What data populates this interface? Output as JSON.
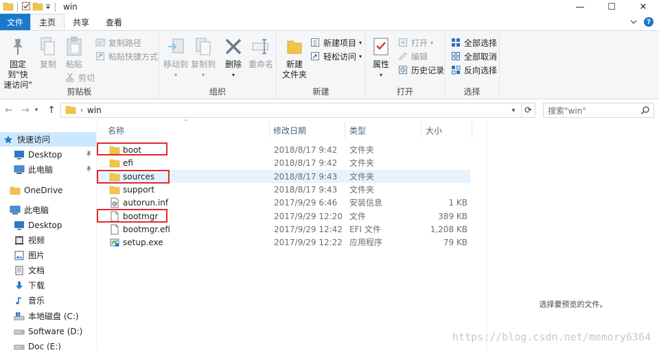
{
  "window": {
    "title": "win",
    "controls": {
      "minimize": "—",
      "maximize": "☐",
      "close": "✕"
    }
  },
  "tabs": [
    {
      "label": "文件"
    },
    {
      "label": "主页"
    },
    {
      "label": "共享"
    },
    {
      "label": "查看"
    }
  ],
  "ribbon": {
    "clipboard": {
      "label": "剪贴板",
      "pin": "固定到\"快\n速访问\"",
      "copy": "复制",
      "paste": "粘贴",
      "copy_path": "复制路径",
      "paste_shortcut": "粘贴快捷方式",
      "cut": "剪切"
    },
    "organize": {
      "label": "组织",
      "move_to": "移动到",
      "copy_to": "复制到",
      "delete": "删除",
      "rename": "重命名"
    },
    "new": {
      "label": "新建",
      "new_folder": "新建\n文件夹",
      "new_item": "新建项目",
      "easy_access": "轻松访问"
    },
    "open": {
      "label": "打开",
      "properties": "属性",
      "open": "打开",
      "edit": "编辑",
      "history": "历史记录"
    },
    "select": {
      "label": "选择",
      "select_all": "全部选择",
      "select_none": "全部取消",
      "invert": "反向选择"
    }
  },
  "address": {
    "path": "win",
    "search_placeholder": "搜索\"win\""
  },
  "navpane": {
    "quick_access": "快速访问",
    "qa_desktop": "Desktop",
    "qa_thispc": "此电脑",
    "onedrive": "OneDrive",
    "thispc": "此电脑",
    "desktop": "Desktop",
    "videos": "视频",
    "pictures": "图片",
    "documents": "文档",
    "downloads": "下载",
    "music": "音乐",
    "drive_c": "本地磁盘 (C:)",
    "drive_d": "Software (D:)",
    "drive_e": "Doc (E:)"
  },
  "columns": {
    "name": "名称",
    "date": "修改日期",
    "type": "类型",
    "size": "大小"
  },
  "files": [
    {
      "name": "boot",
      "date": "2018/8/17 9:42",
      "type": "文件夹",
      "size": "",
      "icon": "folder-icon"
    },
    {
      "name": "efi",
      "date": "2018/8/17 9:42",
      "type": "文件夹",
      "size": "",
      "icon": "folder-icon"
    },
    {
      "name": "sources",
      "date": "2018/8/17 9:43",
      "type": "文件夹",
      "size": "",
      "icon": "folder-icon"
    },
    {
      "name": "support",
      "date": "2018/8/17 9:43",
      "type": "文件夹",
      "size": "",
      "icon": "folder-icon"
    },
    {
      "name": "autorun.inf",
      "date": "2017/9/29 6:46",
      "type": "安装信息",
      "size": "1 KB",
      "icon": "settings-file-icon"
    },
    {
      "name": "bootmgr",
      "date": "2017/9/29 12:20",
      "type": "文件",
      "size": "389 KB",
      "icon": "file-icon"
    },
    {
      "name": "bootmgr.efi",
      "date": "2017/9/29 12:42",
      "type": "EFI 文件",
      "size": "1,208 KB",
      "icon": "file-icon"
    },
    {
      "name": "setup.exe",
      "date": "2017/9/29 12:22",
      "type": "应用程序",
      "size": "79 KB",
      "icon": "setup-icon"
    }
  ],
  "preview": {
    "empty_text": "选择要预览的文件。"
  },
  "watermark": "https://blog.csdn.net/memory6364",
  "colors": {
    "accent": "#1979ca",
    "folder": "#f0c54a",
    "selected_nav": "#cce8ff",
    "hover_row": "#e5f3ff",
    "annotation_red": "#e3262b"
  }
}
